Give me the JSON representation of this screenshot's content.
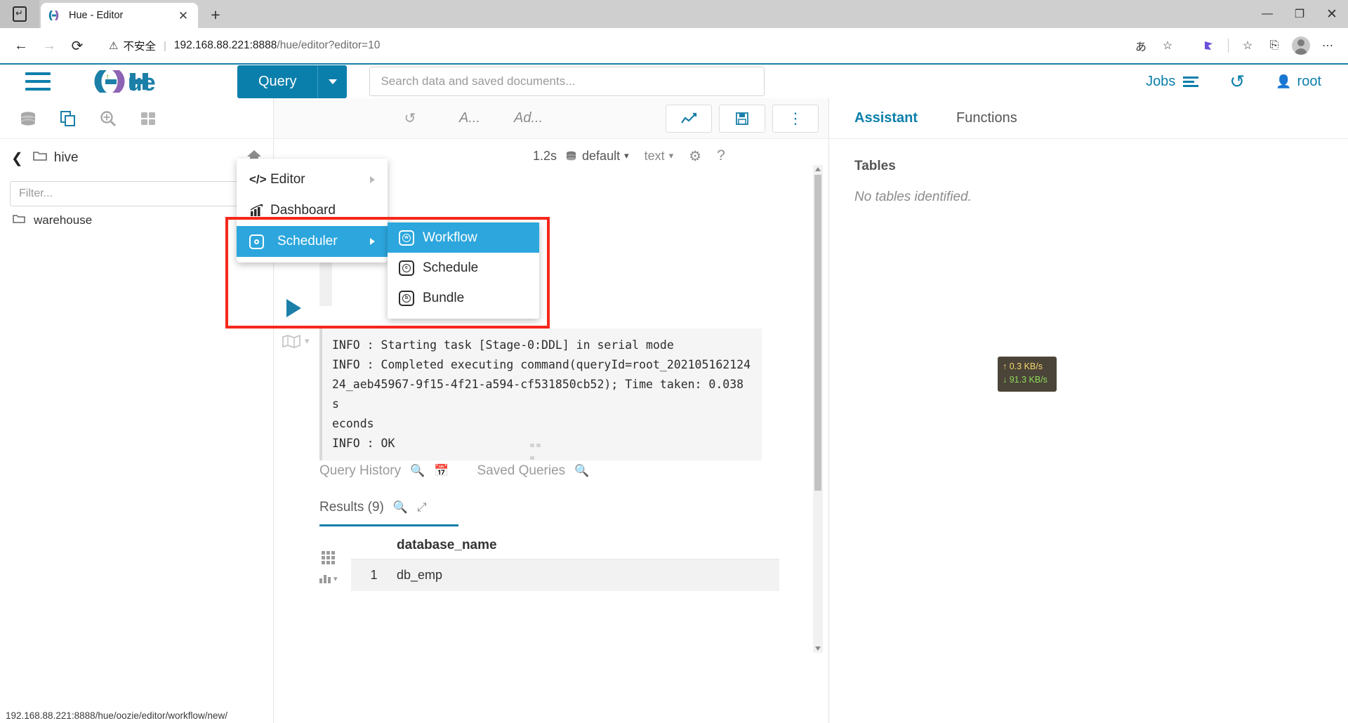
{
  "browser": {
    "tab_title": "Hue - Editor",
    "tab_close": "✕",
    "new_tab": "+",
    "nav": {
      "back": "←",
      "forward": "→",
      "reload": "⟳"
    },
    "security_label": "不安全",
    "separator": "|",
    "url_host": "192.168.88.221:8888",
    "url_path": "/hue/editor?editor=10",
    "toolbar_icons": {
      "translate": "あ",
      "favorite": "☆",
      "extension": "◆",
      "collections": "☆",
      "split_screen": "⎘",
      "settings": "⋯"
    },
    "window": {
      "minimize": "—",
      "maximize": "❐",
      "close": "✕"
    },
    "status_url": "192.168.88.221:8888/hue/oozie/editor/workflow/new/"
  },
  "topbar": {
    "logo_text": "hue",
    "query_button": "Query",
    "search_placeholder": "Search data and saved documents...",
    "jobs_label": "Jobs",
    "history_icon": "↺",
    "user_label": "root"
  },
  "menu": {
    "items": [
      {
        "label": "Editor",
        "icon": "code-icon",
        "glyph": "</>",
        "has_submenu": true,
        "highlight": false
      },
      {
        "label": "Dashboard",
        "icon": "dashboard-icon",
        "glyph": "▥",
        "has_submenu": false,
        "highlight": false
      },
      {
        "label": "Scheduler",
        "icon": "scheduler-icon",
        "glyph": "◎",
        "has_submenu": true,
        "highlight": true
      }
    ],
    "submenu": [
      {
        "label": "Workflow",
        "icon_letter": "w",
        "highlight": true
      },
      {
        "label": "Schedule",
        "icon_letter": "c",
        "highlight": false
      },
      {
        "label": "Bundle",
        "icon_letter": "b",
        "highlight": false
      }
    ]
  },
  "left_panel": {
    "icons": [
      "database-icon",
      "documents-icon",
      "search-plus-icon",
      "apps-grid-icon"
    ],
    "breadcrumb_back": "❮",
    "breadcrumb_label": "hive",
    "filter_placeholder": "Filter...",
    "tree_items": [
      {
        "label": "warehouse",
        "icon": "folder-icon"
      }
    ]
  },
  "editor": {
    "toolbar": {
      "history_icon": "↺",
      "format_label": "A...",
      "advanced_label": "Ad...",
      "chart_icon": "chart-icon",
      "save_icon": "save-icon",
      "more_icon": "⋮"
    },
    "meta": {
      "duration": "1.2s",
      "database": "default",
      "mode": "text",
      "settings_icon": "⚙",
      "help_icon": "?"
    },
    "log_lines": [
      "INFO  : Starting task [Stage-0:DDL] in serial mode",
      "INFO  : Completed executing command(queryId=root_202105162124",
      "24_aeb45967-9f15-4f21-a594-cf531850cb52); Time taken: 0.038 s",
      "econds",
      "INFO  : OK"
    ],
    "tabs": [
      {
        "label": "Query History",
        "icons": [
          "search-icon",
          "calendar-icon"
        ]
      },
      {
        "label": "Saved Queries",
        "icons": [
          "search-icon"
        ]
      }
    ],
    "results_tab": {
      "label": "Results (9)",
      "icons": [
        "search-icon",
        "expand-icon"
      ]
    },
    "results_table": {
      "columns": [
        "database_name"
      ],
      "rows": [
        {
          "index": "1",
          "database_name": "db_emp"
        }
      ]
    }
  },
  "right_panel": {
    "tabs": [
      {
        "label": "Assistant",
        "active": true
      },
      {
        "label": "Functions",
        "active": false
      }
    ],
    "section_title": "Tables",
    "empty_text": "No tables identified."
  },
  "network_badge": {
    "upload": "↑ 0.3 KB/s",
    "download": "↓ 91.3 KB/s"
  },
  "colors": {
    "hue_blue": "#0b7fab",
    "highlight_blue": "#2ca6dd",
    "annotation_red": "#f5281b"
  }
}
